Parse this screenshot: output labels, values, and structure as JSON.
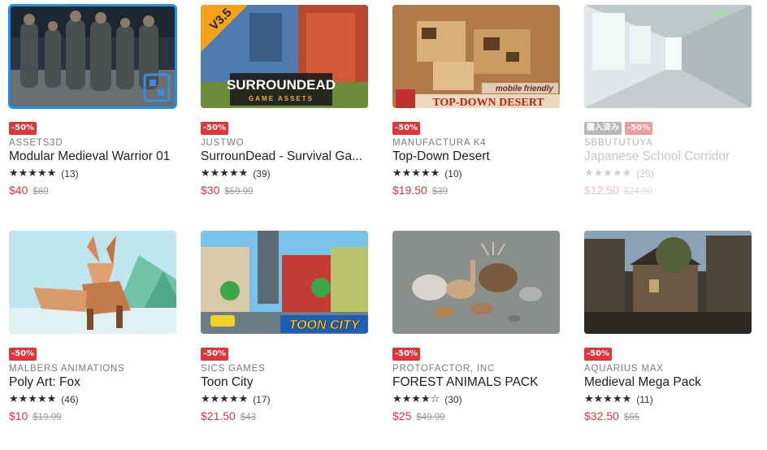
{
  "colors": {
    "accent": "#1e90e8",
    "sale": "#e2353b",
    "owned_badge": "#b8b8b8"
  },
  "products": [
    {
      "publisher": "ASSETS3D",
      "title": "Modular Medieval Warrior 01",
      "badges": [
        "-50%"
      ],
      "stars": "★★★★★",
      "reviews": "(13)",
      "price": "$40",
      "old_price": "$80",
      "rating": 5,
      "thumb_icon": "medieval-warriors-image",
      "thumb_text": ""
    },
    {
      "publisher": "JUSTWO",
      "title": "SurrounDead - Survival Ga...",
      "badges": [
        "-50%"
      ],
      "stars": "★★★★★",
      "reviews": "(39)",
      "price": "$30",
      "old_price": "$59.99",
      "rating": 5,
      "thumb_icon": "surroundead-image",
      "thumb_text": "SURROUNDEAD",
      "thumb_sub": "GAME ASSETS",
      "thumb_ribbon": "V3.5"
    },
    {
      "publisher": "MANUFACTURA K4",
      "title": "Top-Down Desert",
      "badges": [
        "-50%"
      ],
      "stars": "★★★★★",
      "reviews": "(10)",
      "price": "$19.50",
      "old_price": "$39",
      "rating": 5,
      "thumb_icon": "desert-town-image",
      "thumb_text": "TOP-DOWN DESERT",
      "thumb_sub": "mobile friendly"
    },
    {
      "publisher": "SBBUTUTUYA",
      "title": "Japanese School Corridor",
      "badges": [
        "購入済み",
        "-50%"
      ],
      "stars": "★★★★★",
      "reviews": "(25)",
      "price": "$12.50",
      "old_price": "$24.99",
      "rating": 5,
      "thumb_icon": "school-corridor-image",
      "thumb_text": ""
    },
    {
      "publisher": "MALBERS ANIMATIONS",
      "title": "Poly Art: Fox",
      "badges": [
        "-50%"
      ],
      "stars": "★★★★★",
      "reviews": "(46)",
      "price": "$10",
      "old_price": "$19.99",
      "rating": 5,
      "thumb_icon": "poly-fox-image",
      "thumb_text": ""
    },
    {
      "publisher": "SICS GAMES",
      "title": "Toon City",
      "badges": [
        "-50%"
      ],
      "stars": "★★★★★",
      "reviews": "(17)",
      "price": "$21.50",
      "old_price": "$43",
      "rating": 5,
      "thumb_icon": "toon-city-image",
      "thumb_text": "TOON CITY"
    },
    {
      "publisher": "PROTOFACTOR, INC",
      "title": "FOREST ANIMALS PACK",
      "badges": [
        "-50%"
      ],
      "stars": "★★★★☆",
      "reviews": "(30)",
      "price": "$25",
      "old_price": "$49.99",
      "rating": 4,
      "thumb_icon": "forest-animals-image",
      "thumb_text": ""
    },
    {
      "publisher": "AQUARIUS MAX",
      "title": "Medieval Mega Pack",
      "badges": [
        "-50%"
      ],
      "stars": "★★★★★",
      "reviews": "(11)",
      "price": "$32.50",
      "old_price": "$65",
      "rating": 5,
      "thumb_icon": "medieval-village-image",
      "thumb_text": ""
    }
  ]
}
